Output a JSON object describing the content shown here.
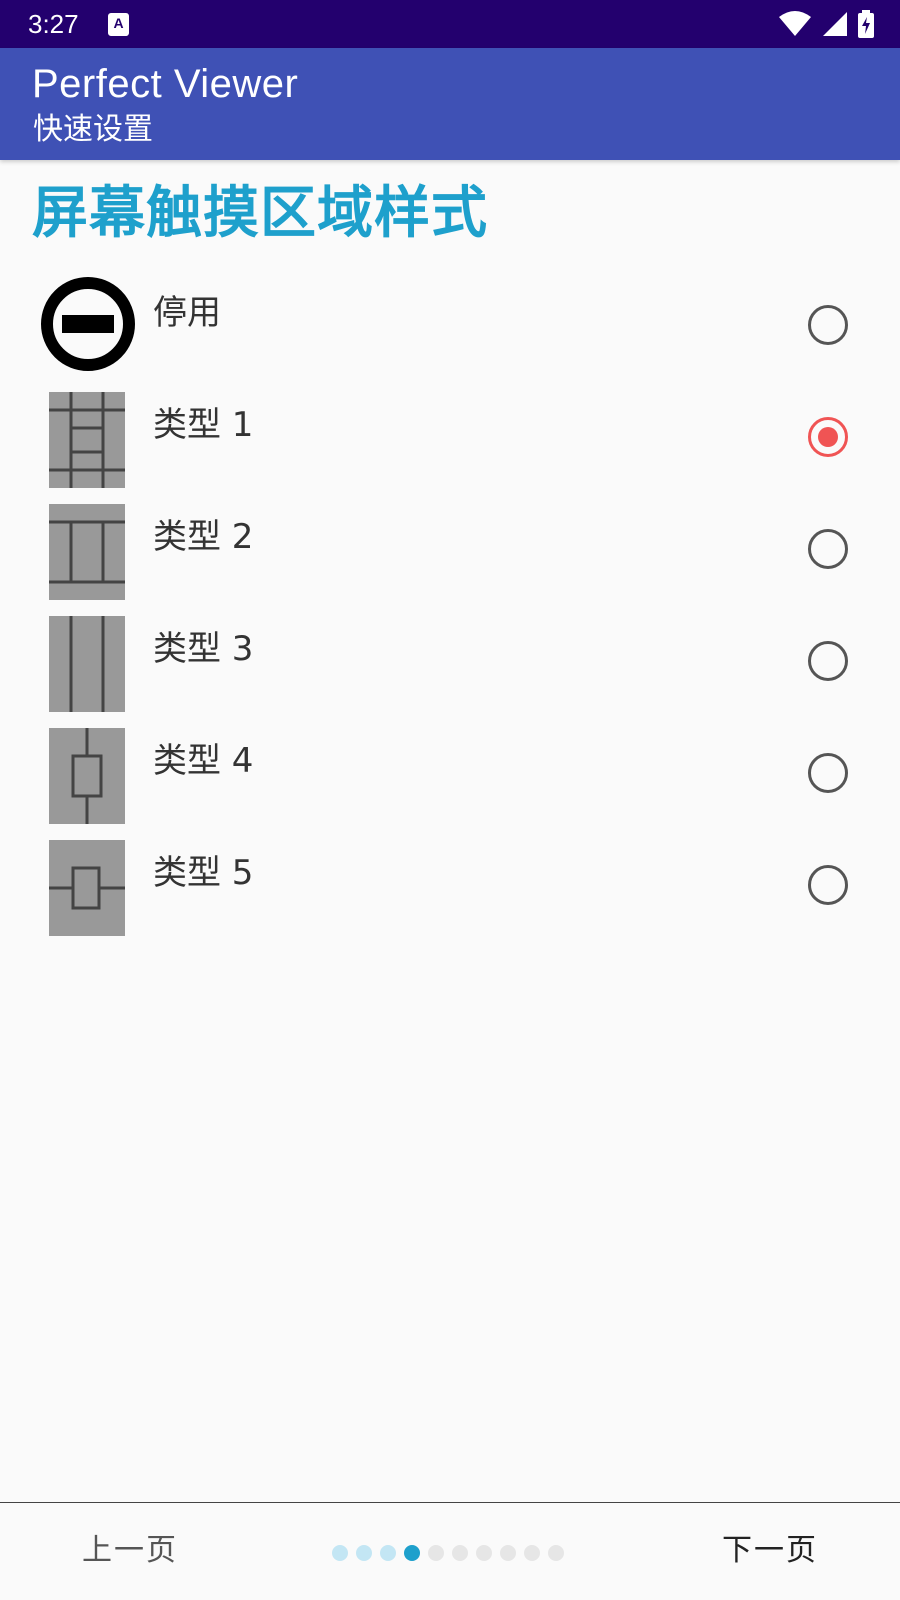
{
  "status_bar": {
    "time": "3:27",
    "notification_icon": "a-keyboard-icon",
    "icons": [
      "wifi-icon",
      "cell-signal-icon",
      "battery-charging-icon"
    ]
  },
  "app_bar": {
    "title": "Perfect Viewer",
    "subtitle": "快速设置",
    "background": "#3f51b5"
  },
  "section": {
    "title": "屏幕触摸区域样式",
    "color": "#1ea0cc"
  },
  "options": [
    {
      "label": "停用",
      "icon": "disable-icon",
      "selected": false
    },
    {
      "label": "类型 1",
      "icon": "touch-layout-type1-icon",
      "selected": true
    },
    {
      "label": "类型 2",
      "icon": "touch-layout-type2-icon",
      "selected": false
    },
    {
      "label": "类型 3",
      "icon": "touch-layout-type3-icon",
      "selected": false
    },
    {
      "label": "类型 4",
      "icon": "touch-layout-type4-icon",
      "selected": false
    },
    {
      "label": "类型 5",
      "icon": "touch-layout-type5-icon",
      "selected": false
    }
  ],
  "navigation": {
    "prev_label": "上一页",
    "next_label": "下一页",
    "page_total": 10,
    "page_current": 4
  },
  "colors": {
    "accent": "#1ea0cc",
    "radio_selected": "#f05454",
    "status_bar": "#23006e"
  }
}
